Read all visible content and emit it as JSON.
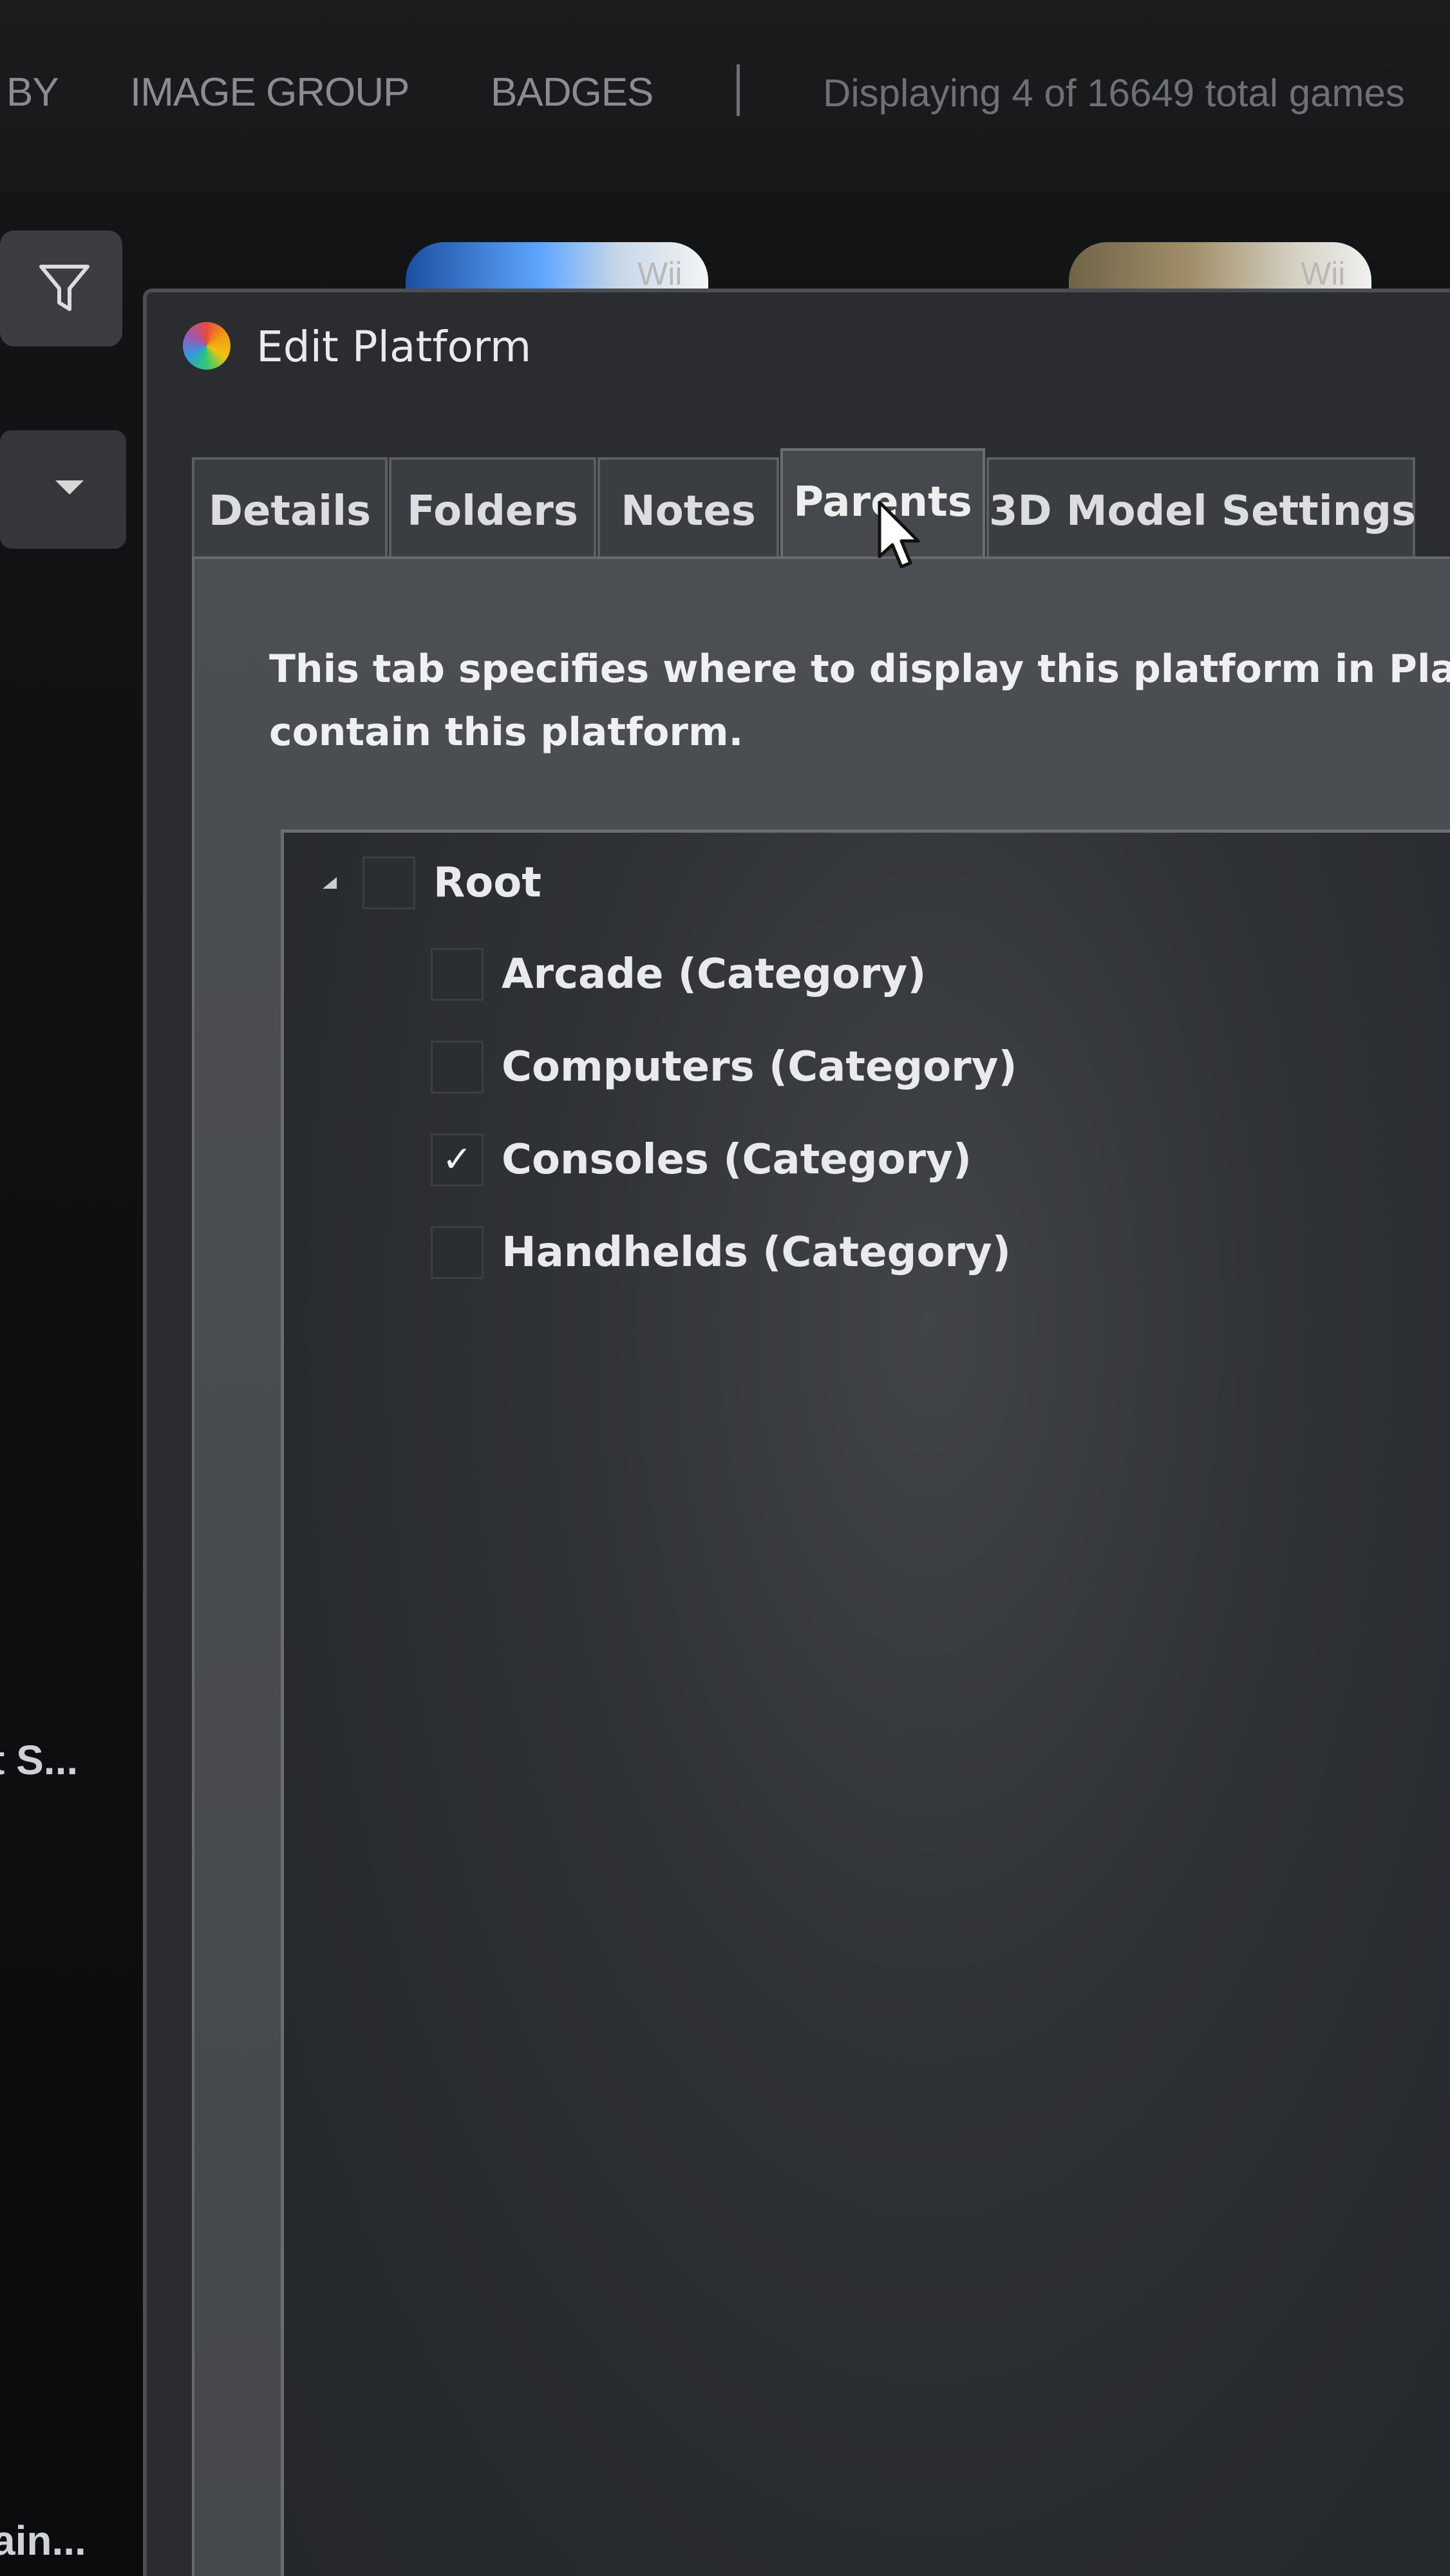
{
  "topbar": {
    "items": [
      "BY",
      "IMAGE GROUP",
      "BADGES"
    ],
    "status": "Displaying 4 of 16649 total games"
  },
  "thumbnails": [
    {
      "label": "Wii",
      "color": "#3f7fd0"
    },
    {
      "label": "Wii",
      "color": "#8a7a5c"
    }
  ],
  "sidebar": {
    "truncated_texts": [
      "t S...",
      "ain..."
    ]
  },
  "dialog": {
    "title": "Edit Platform",
    "icon": "platform-icon",
    "tabs": [
      {
        "label": "Details",
        "active": false
      },
      {
        "label": "Folders",
        "active": false
      },
      {
        "label": "Notes",
        "active": false
      },
      {
        "label": "Parents",
        "active": true
      },
      {
        "label": "3D Model Settings",
        "active": false
      }
    ],
    "description_lines": [
      "This tab specifies where to display this platform in Platform",
      "contain this platform."
    ],
    "tree": {
      "root": {
        "label": "Root",
        "checked": false,
        "expanded": true
      },
      "children": [
        {
          "label": "Arcade (Category)",
          "checked": false
        },
        {
          "label": "Computers (Category)",
          "checked": false
        },
        {
          "label": "Consoles (Category)",
          "checked": true
        },
        {
          "label": "Handhelds (Category)",
          "checked": false
        }
      ],
      "check_glyph": "✓"
    }
  },
  "colors": {
    "dialog_bg": "#2a2c2f",
    "panel_bg": "#4b4e53",
    "tree_bg": "#2f3236",
    "text": "#e8eaec"
  }
}
